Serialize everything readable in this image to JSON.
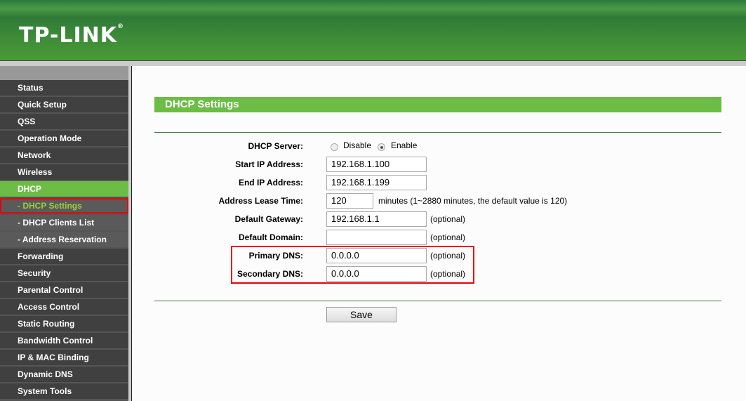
{
  "brand": {
    "logo": "TP-LINK",
    "reg": "®"
  },
  "sidebar": {
    "items": [
      {
        "label": "Status"
      },
      {
        "label": "Quick Setup"
      },
      {
        "label": "QSS"
      },
      {
        "label": "Operation Mode"
      },
      {
        "label": "Network"
      },
      {
        "label": "Wireless"
      },
      {
        "label": "DHCP"
      },
      {
        "label": "- DHCP Settings"
      },
      {
        "label": "- DHCP Clients List"
      },
      {
        "label": "- Address Reservation"
      },
      {
        "label": "Forwarding"
      },
      {
        "label": "Security"
      },
      {
        "label": "Parental Control"
      },
      {
        "label": "Access Control"
      },
      {
        "label": "Static Routing"
      },
      {
        "label": "Bandwidth Control"
      },
      {
        "label": "IP & MAC Binding"
      },
      {
        "label": "Dynamic DNS"
      },
      {
        "label": "System Tools"
      }
    ]
  },
  "page": {
    "title": "DHCP Settings"
  },
  "form": {
    "dhcp_server_label": "DHCP Server:",
    "disable": "Disable",
    "enable": "Enable",
    "dhcp_server_value": "Enable",
    "start_ip_label": "Start IP Address:",
    "start_ip": "192.168.1.100",
    "end_ip_label": "End IP Address:",
    "end_ip": "192.168.1.199",
    "lease_label": "Address Lease Time:",
    "lease": "120",
    "lease_note": "minutes (1~2880 minutes, the default value is 120)",
    "gateway_label": "Default Gateway:",
    "gateway": "192.168.1.1",
    "domain_label": "Default Domain:",
    "domain": "",
    "dns1_label": "Primary DNS:",
    "dns1": "0.0.0.0",
    "dns2_label": "Secondary DNS:",
    "dns2": "0.0.0.0",
    "optional": "(optional)",
    "save": "Save"
  }
}
